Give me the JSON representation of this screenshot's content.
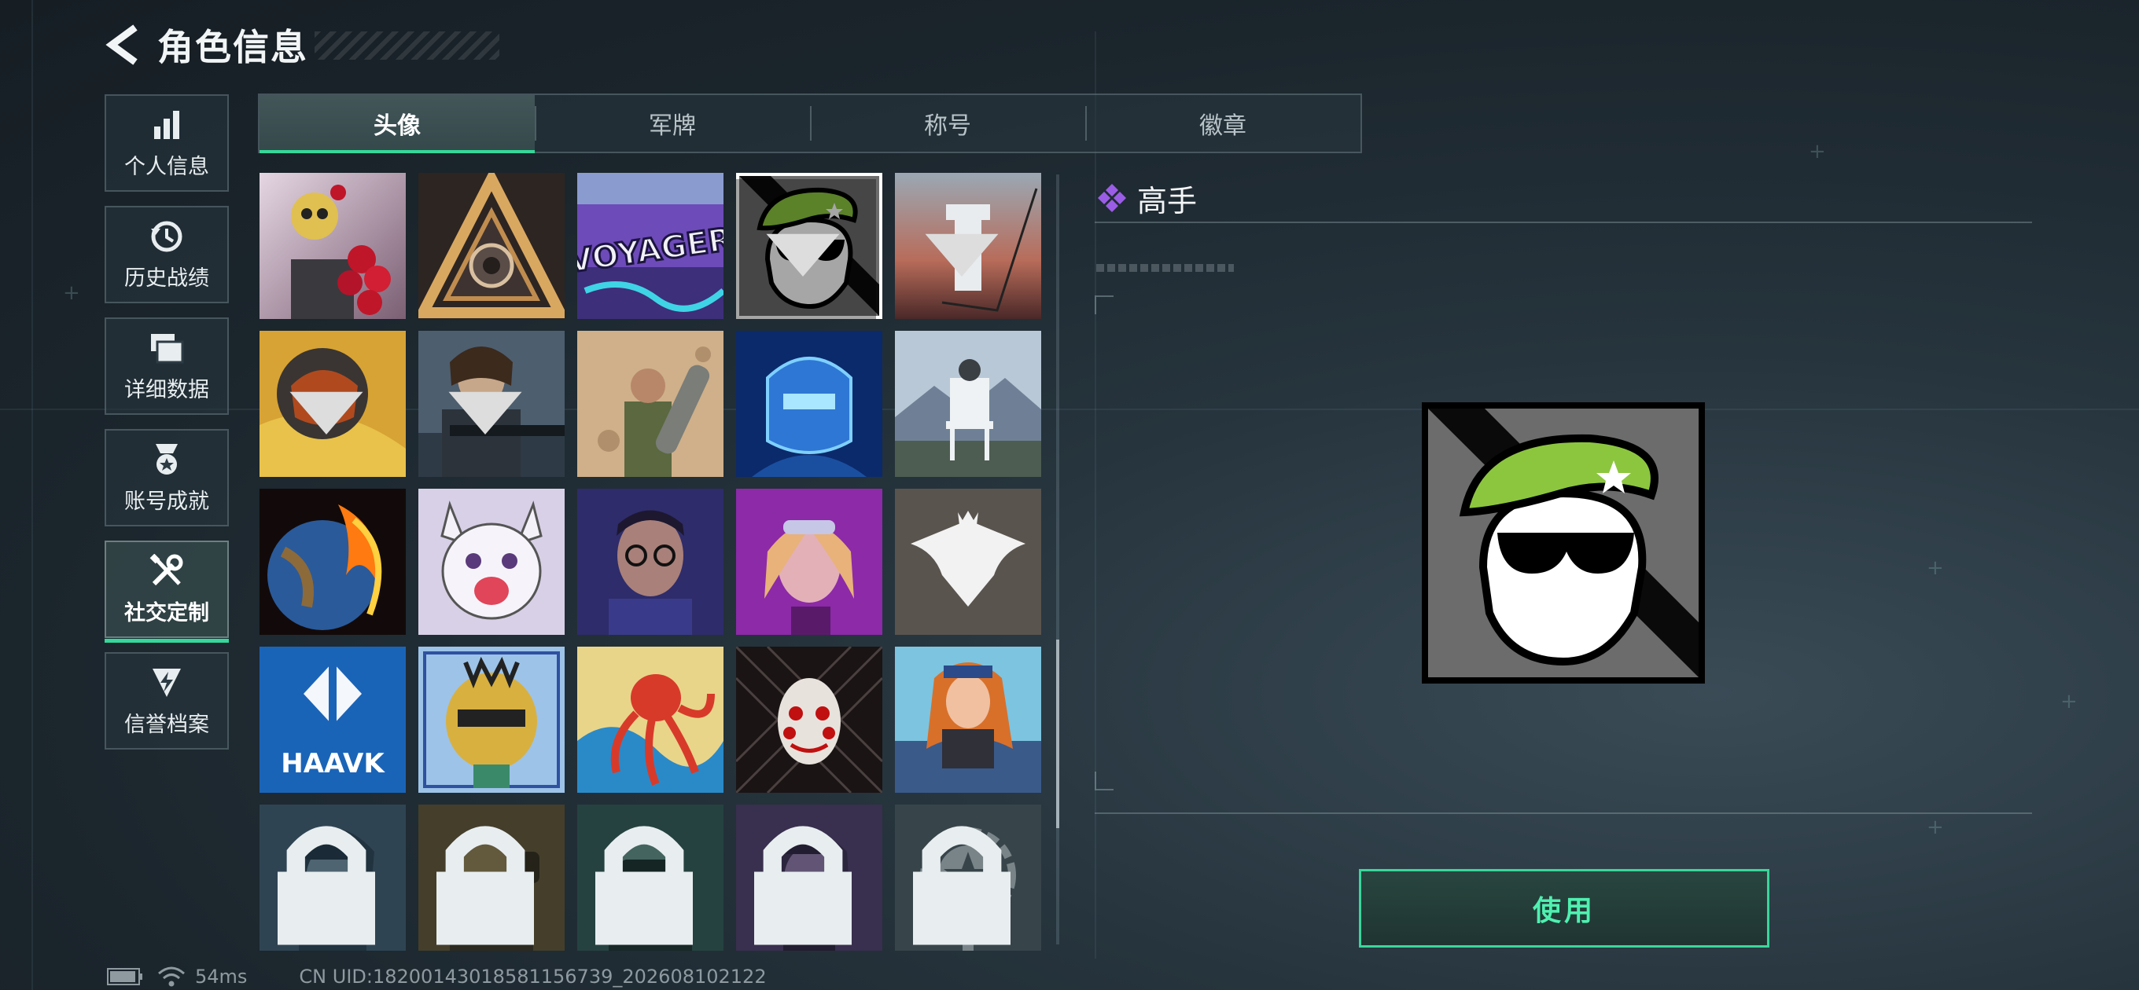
{
  "header": {
    "title": "角色信息"
  },
  "sidebar": {
    "items": [
      {
        "label": "个人信息"
      },
      {
        "label": "历史战绩"
      },
      {
        "label": "详细数据"
      },
      {
        "label": "账号成就"
      },
      {
        "label": "社交定制",
        "active": true
      },
      {
        "label": "信誉档案"
      }
    ]
  },
  "tabs": [
    {
      "label": "头像",
      "active": true
    },
    {
      "label": "军牌"
    },
    {
      "label": "称号"
    },
    {
      "label": "徽章"
    }
  ],
  "avatars": [
    {
      "name": "skull-roses"
    },
    {
      "name": "gold-triangle"
    },
    {
      "name": "voyager-graffiti",
      "text": "VOYAGER"
    },
    {
      "name": "green-beret-skull",
      "selected": true
    },
    {
      "name": "tower-sunset"
    },
    {
      "name": "armored-helmet"
    },
    {
      "name": "soldier-rifle"
    },
    {
      "name": "soldier-desert"
    },
    {
      "name": "blue-robot"
    },
    {
      "name": "chair-mountain"
    },
    {
      "name": "burning-planet"
    },
    {
      "name": "anime-cat"
    },
    {
      "name": "man-glasses"
    },
    {
      "name": "woman-purple"
    },
    {
      "name": "eagle-emblem"
    },
    {
      "name": "haavk-logo",
      "text": "HAAVK"
    },
    {
      "name": "gold-mask"
    },
    {
      "name": "red-octopus"
    },
    {
      "name": "jigsaw-mask"
    },
    {
      "name": "redhead-girl"
    },
    {
      "name": "pilot-woman",
      "locked": true
    },
    {
      "name": "bearded-man",
      "locked": true
    },
    {
      "name": "man-goggles",
      "locked": true
    },
    {
      "name": "woman-goggles",
      "locked": true
    },
    {
      "name": "star-emblem",
      "locked": true
    }
  ],
  "detail": {
    "rarity_color": "#9b5de5",
    "name": "高手",
    "use_label": "使用"
  },
  "status": {
    "ping": "54ms",
    "uid": "CN UID:18200143018581156739_202608102122"
  },
  "colors": {
    "accent": "#35d89a",
    "beret": "#8cc63f"
  }
}
